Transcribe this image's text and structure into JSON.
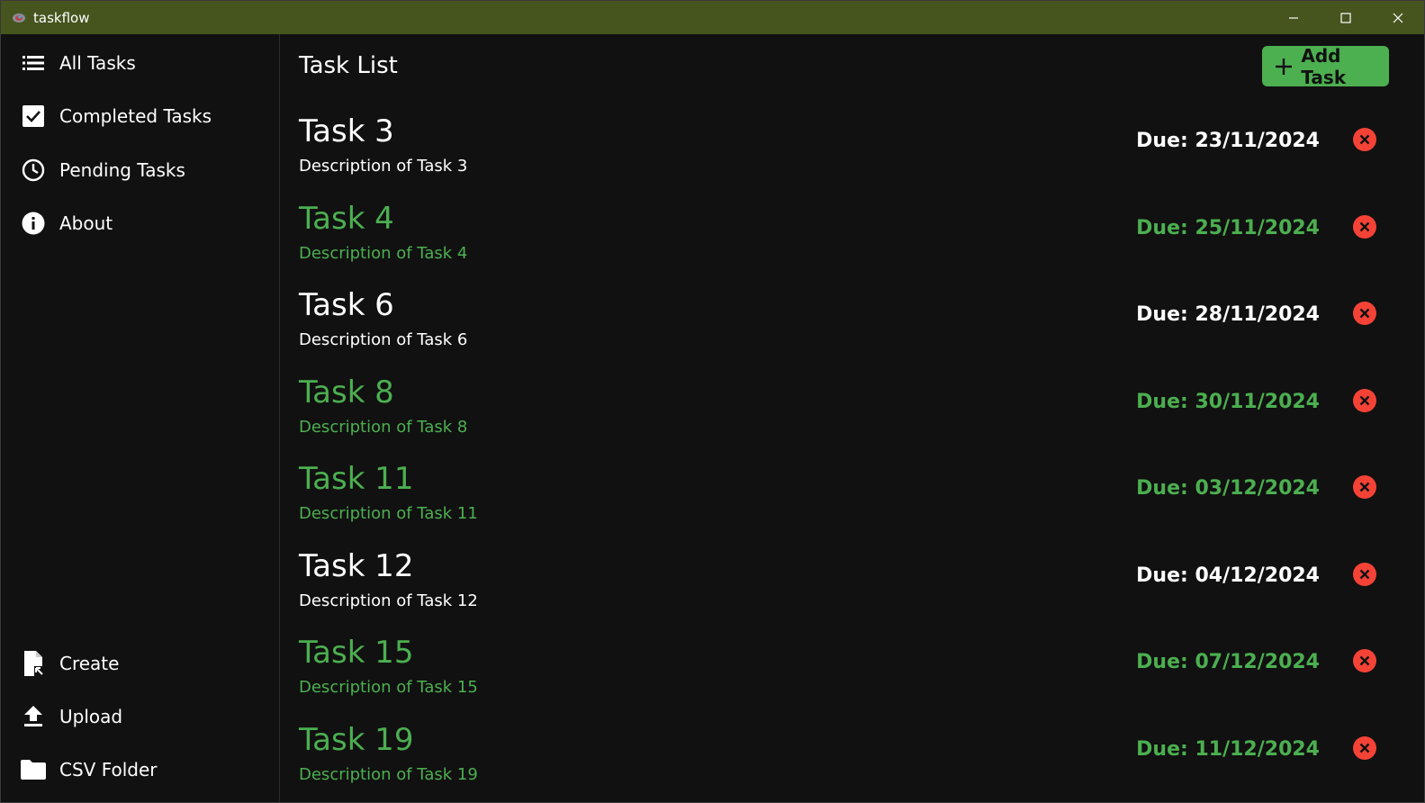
{
  "window": {
    "title": "taskflow"
  },
  "sidebar": {
    "top_items": [
      {
        "label": "All Tasks",
        "icon": "list-icon"
      },
      {
        "label": "Completed Tasks",
        "icon": "checkbox-icon"
      },
      {
        "label": "Pending Tasks",
        "icon": "clock-icon"
      },
      {
        "label": "About",
        "icon": "info-icon"
      }
    ],
    "bottom_items": [
      {
        "label": "Create",
        "icon": "file-create-icon"
      },
      {
        "label": "Upload",
        "icon": "upload-icon"
      },
      {
        "label": "CSV Folder",
        "icon": "folder-icon"
      }
    ]
  },
  "main": {
    "title": "Task List",
    "add_button": "Add Task",
    "tasks": [
      {
        "title": "Task 3",
        "description": "Description of Task 3",
        "due": "Due: 23/11/2024",
        "status": "pending"
      },
      {
        "title": "Task 4",
        "description": "Description of Task 4",
        "due": "Due: 25/11/2024",
        "status": "completed"
      },
      {
        "title": "Task 6",
        "description": "Description of Task 6",
        "due": "Due: 28/11/2024",
        "status": "pending"
      },
      {
        "title": "Task 8",
        "description": "Description of Task 8",
        "due": "Due: 30/11/2024",
        "status": "completed"
      },
      {
        "title": "Task 11",
        "description": "Description of Task 11",
        "due": "Due: 03/12/2024",
        "status": "completed"
      },
      {
        "title": "Task 12",
        "description": "Description of Task 12",
        "due": "Due: 04/12/2024",
        "status": "pending"
      },
      {
        "title": "Task 15",
        "description": "Description of Task 15",
        "due": "Due: 07/12/2024",
        "status": "completed"
      },
      {
        "title": "Task 19",
        "description": "Description of Task 19",
        "due": "Due: 11/12/2024",
        "status": "completed"
      }
    ]
  },
  "colors": {
    "titlebar": "#46541e",
    "accent": "#4caf50",
    "delete": "#f44336",
    "background": "#111111"
  }
}
